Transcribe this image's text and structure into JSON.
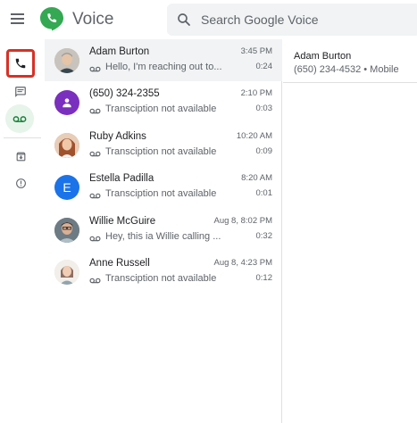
{
  "header": {
    "app_title": "Voice",
    "search_placeholder": "Search Google Voice"
  },
  "colors": {
    "brand_green": "#34a853",
    "selection_highlight": "#d93025",
    "voicemail_active_bg": "#e6f4ea"
  },
  "nav": {
    "items": [
      {
        "name": "calls",
        "icon": "phone-icon",
        "selected": true
      },
      {
        "name": "messages",
        "icon": "message-icon"
      },
      {
        "name": "voicemail",
        "icon": "voicemail-icon",
        "active": true
      },
      {
        "name": "archive",
        "icon": "archive-icon"
      },
      {
        "name": "spam",
        "icon": "spam-icon"
      }
    ]
  },
  "list": {
    "items": [
      {
        "name": "Adam Burton",
        "time": "3:45 PM",
        "snippet": "Hello, I'm reaching out to...",
        "duration": "0:24",
        "avatar_type": "photo",
        "avatar_bg": "#c9c3bd",
        "selected": true
      },
      {
        "name": "(650) 324-2355",
        "time": "2:10 PM",
        "snippet": "Transciption not available",
        "duration": "0:03",
        "avatar_type": "person",
        "avatar_bg": "#7b2fbe"
      },
      {
        "name": "Ruby Adkins",
        "time": "10:20 AM",
        "snippet": "Transciption not available",
        "duration": "0:09",
        "avatar_type": "photo",
        "avatar_bg": "#d9a98a"
      },
      {
        "name": "Estella Padilla",
        "time": "8:20 AM",
        "snippet": "Transciption not available",
        "duration": "0:01",
        "avatar_type": "letter",
        "avatar_letter": "E",
        "avatar_bg": "#1a73e8"
      },
      {
        "name": "Willie McGuire",
        "time": "Aug 8, 8:02 PM",
        "snippet": "Hey, this ia Willie calling ...",
        "duration": "0:32",
        "avatar_type": "photo",
        "avatar_bg": "#8d8f93"
      },
      {
        "name": "Anne Russell",
        "time": "Aug 8, 4:23 PM",
        "snippet": "Transciption not available",
        "duration": "0:12",
        "avatar_type": "photo",
        "avatar_bg": "#e8e0d8"
      }
    ]
  },
  "detail": {
    "name": "Adam Burton",
    "phone": "(650) 234-4532 • Mobile"
  }
}
